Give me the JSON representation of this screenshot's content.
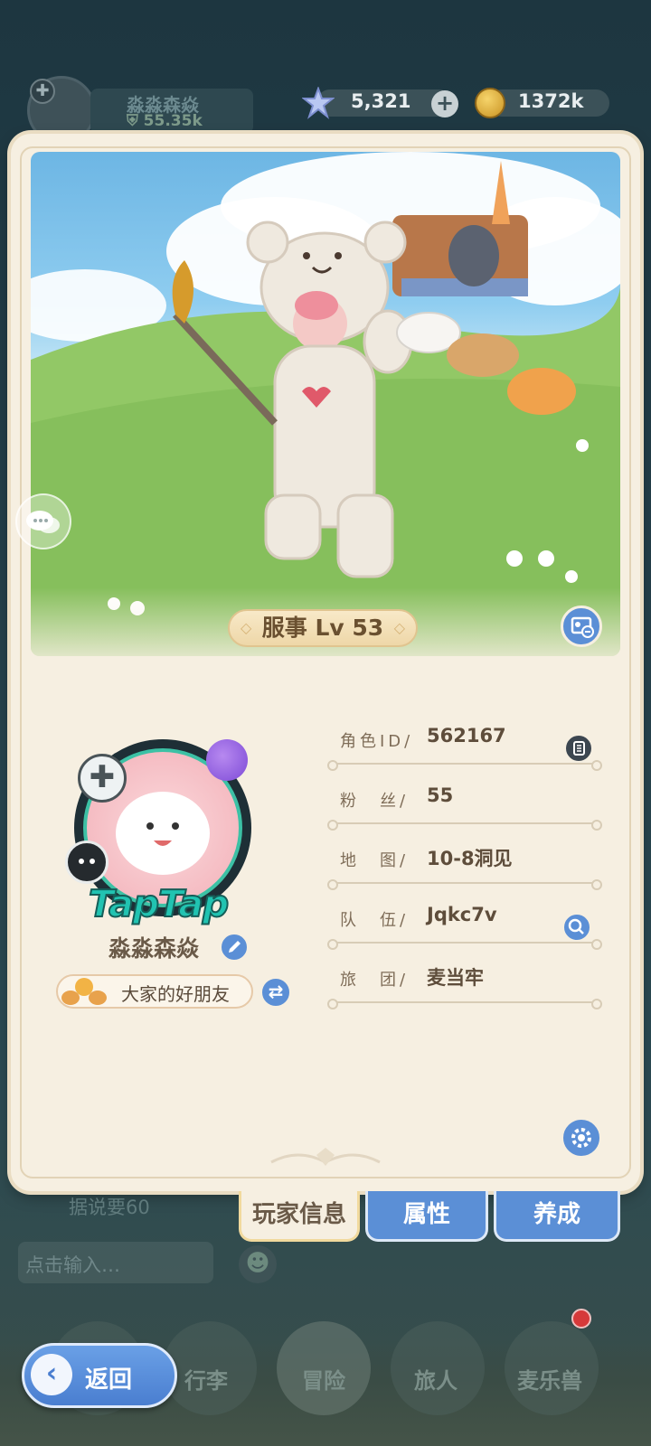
{
  "hud": {
    "player_name": "淼淼森焱",
    "power": "55.35k",
    "gems": "5,321",
    "coins": "1372k",
    "icons": [
      "crosshair-icon",
      "gem-icon",
      "plus-icon",
      "coin-icon"
    ]
  },
  "scene": {
    "level_badge": "服事 Lv 53",
    "icons": [
      "chat-bubble-icon",
      "profile-card-icon"
    ]
  },
  "profile": {
    "avatar_frame_text": "TapTap",
    "name": "淼淼森焱",
    "title": "大家的好朋友",
    "icons": [
      "edit-icon",
      "swap-icon",
      "copy-icon",
      "search-icon",
      "settings-icon"
    ]
  },
  "info": {
    "rows": [
      {
        "label": "角色ID/",
        "value": "562167"
      },
      {
        "label": "粉　丝/",
        "value": "55"
      },
      {
        "label": "地　图/",
        "value": "10-8洞见"
      },
      {
        "label": "队　伍/",
        "value": "Jqkc7v"
      },
      {
        "label": "旅　团/",
        "value": "麦当牢"
      }
    ]
  },
  "tabs": [
    "玩家信息",
    "属性",
    "养成"
  ],
  "background": {
    "chat_message": "据说要60",
    "chat_placeholder": "点击输入…",
    "nav": [
      "行李",
      "冒险",
      "旅人",
      "麦乐兽"
    ],
    "back_label": "返回"
  },
  "colors": {
    "panel": "#f6efe1",
    "accent_blue": "#5b8fd6",
    "text_brown": "#5e4d3b",
    "teal": "#21c3b1"
  }
}
